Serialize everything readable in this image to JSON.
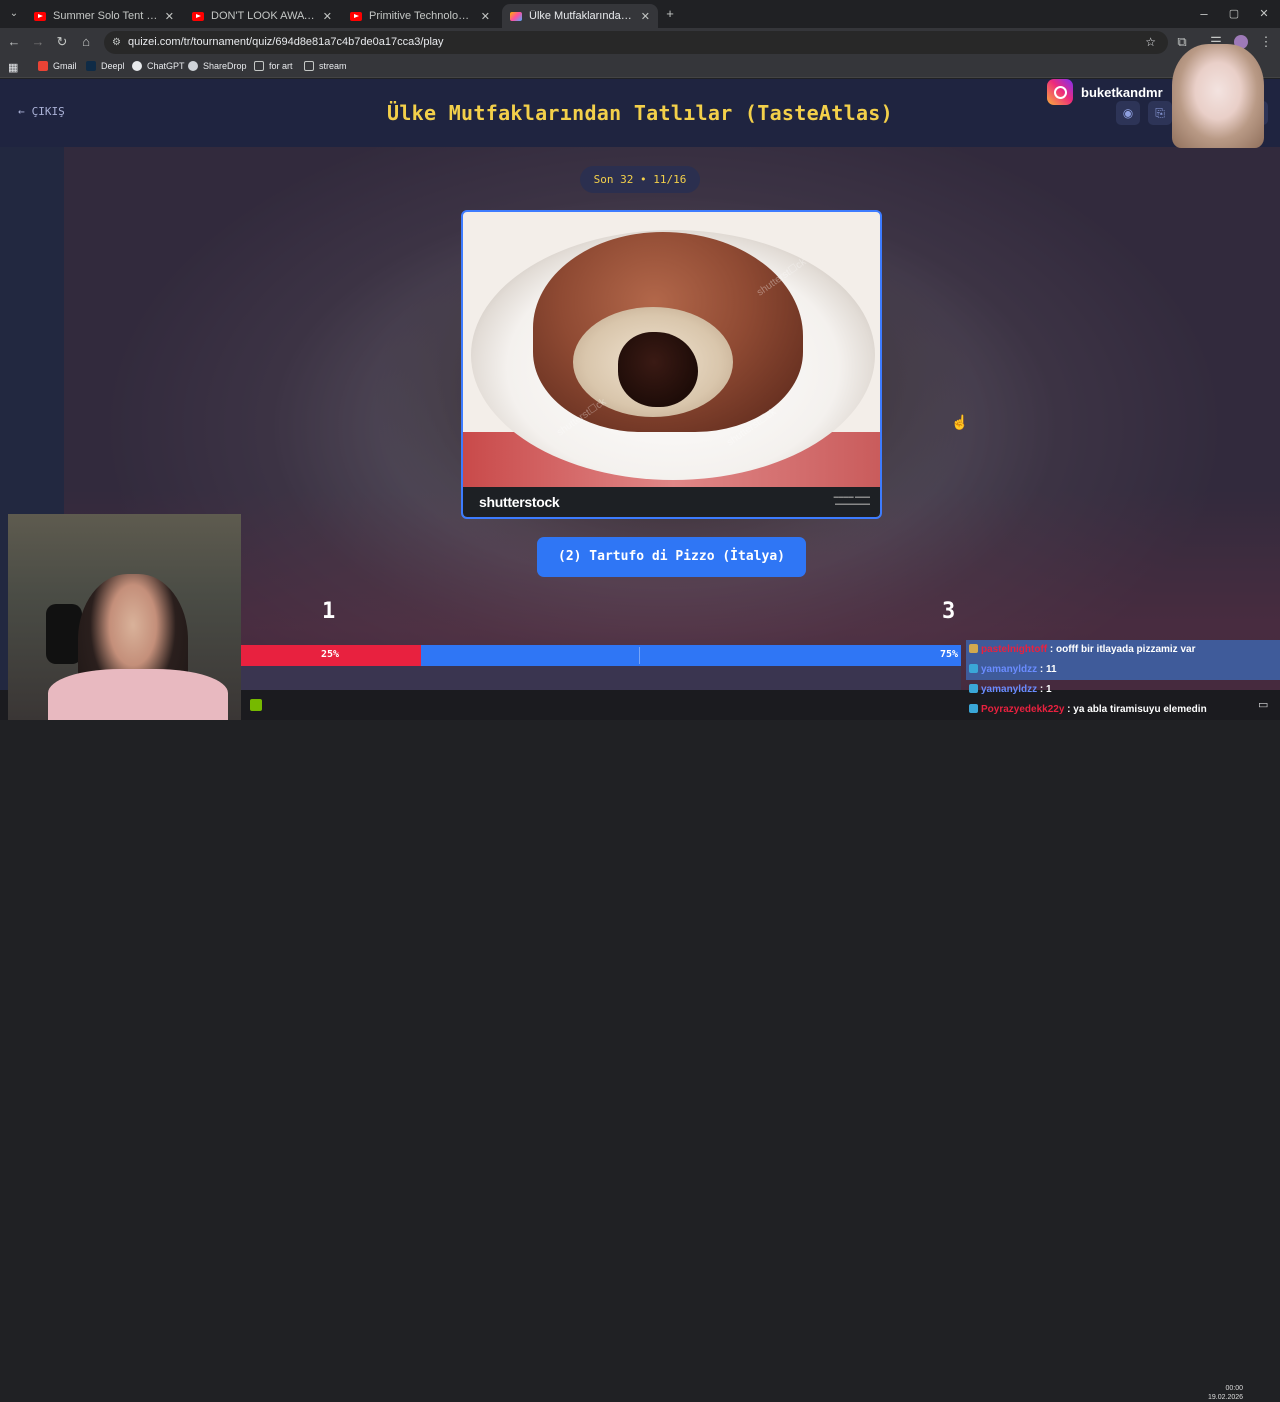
{
  "browser": {
    "tabs": [
      {
        "title": "Summer Solo Tent Camp--Goin",
        "icon": "youtube-icon"
      },
      {
        "title": "DON'T LOOK AWAY | Horror Sh",
        "icon": "youtube-icon"
      },
      {
        "title": "Primitive Technology: Tiled Roo",
        "icon": "youtube-icon"
      },
      {
        "title": "Ülke Mutfaklarından Tatlılar (Ta",
        "icon": "quizei-icon"
      }
    ],
    "url": "quizei.com/tr/tournament/quiz/694d8e81a7c4b7de0a17cca3/play",
    "bookmarks": [
      "Gmail",
      "Deepl",
      "ChatGPT",
      "ShareDrop",
      "for art",
      "stream"
    ]
  },
  "page": {
    "exit_label": "ÇIKIŞ",
    "title": "Ülke Mutfaklarından Tatlılar (TasteAtlas)",
    "round": "Son 32 • 11/16",
    "image_watermark": "shutterstock",
    "choice_label": "(2) Tartufo di Pizzo (İtalya)",
    "score_left": "1",
    "score_right": "3",
    "vote_left_pct": "25%",
    "vote_right_pct": "75%",
    "vote_left_fraction": 0.25
  },
  "overlay": {
    "instagram_name": "buketkandmr",
    "clock_time": "00:00",
    "clock_date": "19.02.2026",
    "chat": [
      {
        "user": "pastelnightoff",
        "message": ": oofff bir itlayada pizzamiz var",
        "color": "#e8213f",
        "highlight": true
      },
      {
        "user": "yamanyldzz",
        "message": ": 11",
        "color": "#6a8cff",
        "highlight": true
      },
      {
        "user": "yamanyldzz",
        "message": ": 1",
        "color": "#6a8cff",
        "highlight": false
      },
      {
        "user": "Poyrazyedekk22y",
        "message": ": ya abla tiramisuyu elemedin",
        "color": "#e8213f",
        "highlight": false
      }
    ]
  },
  "colors": {
    "accent_blue": "#2f76f5",
    "vote_red": "#e8213f",
    "title_yellow": "#f3d04a"
  }
}
